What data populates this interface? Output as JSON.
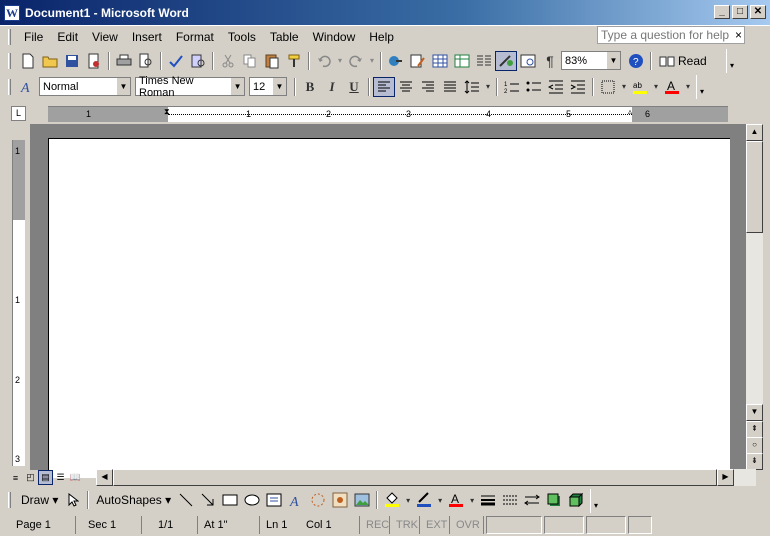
{
  "window": {
    "title": "Document1 - Microsoft Word",
    "minimize": "_",
    "maximize": "□",
    "close": "✕"
  },
  "menu": {
    "items": [
      "File",
      "Edit",
      "View",
      "Insert",
      "Format",
      "Tools",
      "Table",
      "Window",
      "Help"
    ],
    "help_placeholder": "Type a question for help",
    "help_close": "×"
  },
  "standard_toolbar": {
    "zoom": "83%",
    "read_label": "Read"
  },
  "formatting_toolbar": {
    "style": "Normal",
    "font": "Times New Roman",
    "size": "12",
    "bold": "B",
    "italic": "I",
    "underline": "U"
  },
  "ruler": {
    "h_numbers": [
      "1",
      "1",
      "2",
      "3",
      "4",
      "5",
      "6"
    ],
    "v_numbers": [
      "1",
      "1",
      "2",
      "3"
    ]
  },
  "drawing_toolbar": {
    "draw_label": "Draw",
    "autoshapes_label": "AutoShapes"
  },
  "status": {
    "page": "Page 1",
    "sec": "Sec 1",
    "pages": "1/1",
    "at": "At 1\"",
    "ln": "Ln 1",
    "col": "Col 1",
    "rec": "REC",
    "trk": "TRK",
    "ext": "EXT",
    "ovr": "OVR"
  },
  "colors": {
    "title_start": "#0a246a",
    "title_end": "#a6caf0",
    "highlight": "#ffff00",
    "font_color": "#ff0000",
    "chrome": "#d4d0c8"
  }
}
